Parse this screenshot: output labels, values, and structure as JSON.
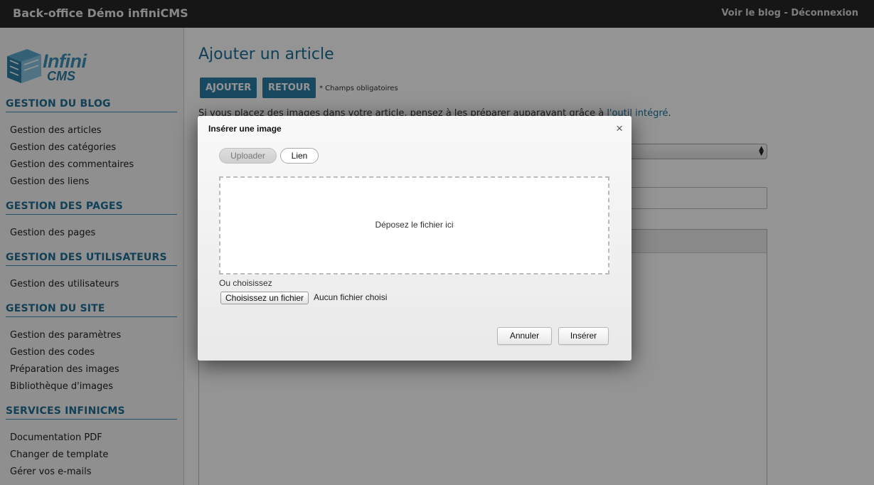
{
  "header": {
    "brand": "Back-office Démo infiniCMS",
    "view_blog": "Voir le blog",
    "separator": " - ",
    "logout": "Déconnexion"
  },
  "logo": {
    "line1": "Infini",
    "line2": "CMS"
  },
  "sidebar": {
    "sections": [
      {
        "title": "GESTION DU BLOG",
        "items": [
          "Gestion des articles",
          "Gestion des catégories",
          "Gestion des commentaires",
          "Gestion des liens"
        ]
      },
      {
        "title": "GESTION DES PAGES",
        "items": [
          "Gestion des pages"
        ]
      },
      {
        "title": "GESTION DES UTILISATEURS",
        "items": [
          "Gestion des utilisateurs"
        ]
      },
      {
        "title": "GESTION DU SITE",
        "items": [
          "Gestion des paramètres",
          "Gestion des codes",
          "Préparation des images",
          "Bibliothèque d'images"
        ]
      },
      {
        "title": "SERVICES INFINICMS",
        "items": [
          "Documentation PDF",
          "Changer de template",
          "Gérer vos e-mails"
        ]
      }
    ]
  },
  "main": {
    "title": "Ajouter un article",
    "add_button": "AJOUTER",
    "back_button": "RETOUR",
    "mandatory_note": "* Champs obligatoires",
    "info_prefix": "Si vous placez des images dans votre article, pensez à les préparer auparavant grâce à ",
    "info_link": "l'outil intégré",
    "info_suffix": "."
  },
  "modal": {
    "title": "Insérer une image",
    "close": "×",
    "tab_upload": "Uploader",
    "tab_link": "Lien",
    "dropzone_text": "Déposez le fichier ici",
    "or_choose": "Ou choisissez",
    "file_button": "Choisissez un fichier",
    "file_status": "Aucun fichier choisi",
    "cancel_button": "Annuler",
    "insert_button": "Insérer"
  },
  "colors": {
    "accent": "#2b7fa8",
    "section_title": "#1e6e96",
    "topbar": "#262626"
  }
}
